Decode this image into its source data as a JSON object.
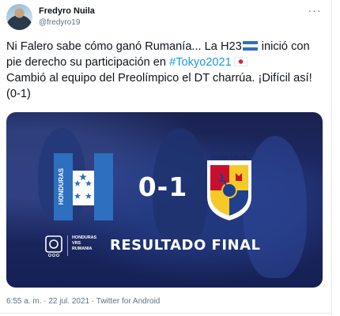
{
  "tweet": {
    "author_name": "Fredyro Nuila",
    "author_handle": "@fredyro19",
    "text_part1": "Ni Falero sabe cómo ganó Rumanía... La H23",
    "text_part2": " inició con pie derecho su participación en ",
    "hashtag": "#Tokyo2021",
    "text_part3": "Cambió al equipo del Preolímpico el DT charrúa. ¡Difícil así! (0-1)",
    "timestamp": "6:55 a. m. · 22 jul. 2021 · ",
    "source": "Twitter for Android"
  },
  "media": {
    "home_team_vertical": "HONDURAS",
    "score": "0-1",
    "away_team": "ROMÂNIA",
    "match_lines": [
      "HONDURAS",
      "VRS",
      "RUMANIA"
    ],
    "result_label": "RESULTADO FINAL"
  },
  "colors": {
    "link": "#1b95e0",
    "honduras_blue": "#2f6fbf",
    "media_bg": "#1e2a66"
  },
  "icons": {
    "more": "more-dots-icon",
    "flag_honduras": "honduras-flag-icon",
    "flag_japan": "japan-flag-icon",
    "olympic": "olympic-badge-icon"
  }
}
